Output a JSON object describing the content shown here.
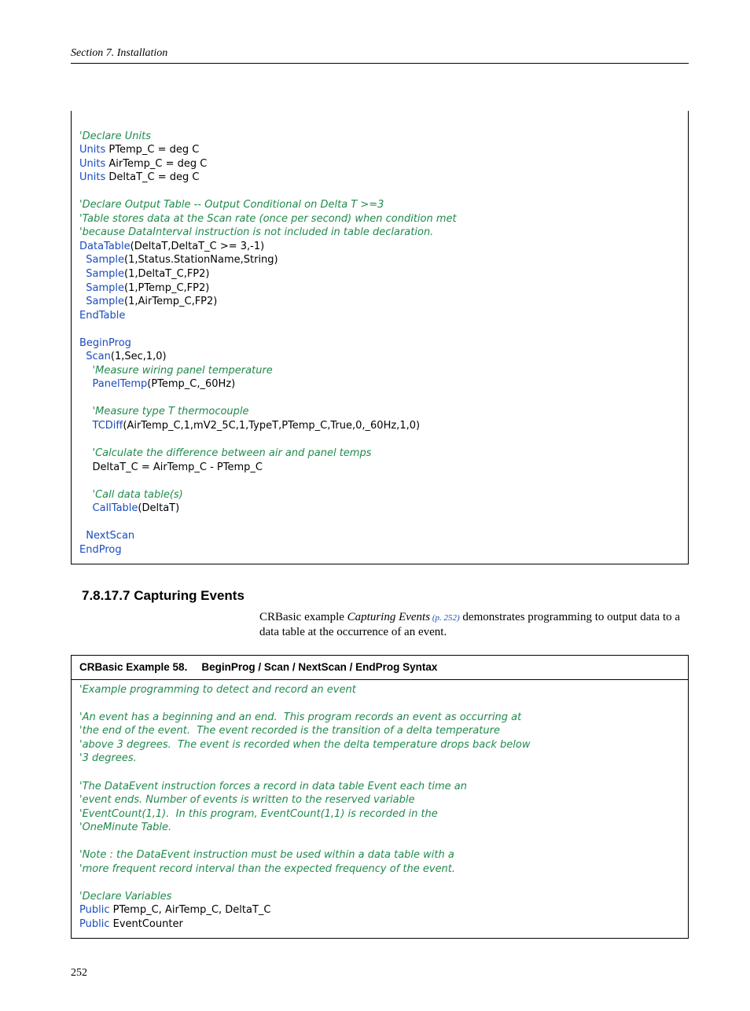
{
  "header": {
    "running": "Section 7.  Installation"
  },
  "code1": {
    "l1": "'Declare Units",
    "l2a": "Units",
    "l2b": " PTemp_C = deg C",
    "l3a": "Units",
    "l3b": " AirTemp_C = deg C",
    "l4a": "Units",
    "l4b": " DeltaT_C = deg C",
    "l5": "'Declare Output Table -- Output Conditional on Delta T >=3",
    "l6": "'Table stores data at the Scan rate (once per second) when condition met",
    "l7": "'because DataInterval instruction is not included in table declaration.",
    "l8a": "DataTable",
    "l8b": "(DeltaT,DeltaT_C >= 3,-1)",
    "l9a": "  Sample",
    "l9b": "(1,Status.StationName,String)",
    "l10a": "  Sample",
    "l10b": "(1,DeltaT_C,FP2)",
    "l11a": "  Sample",
    "l11b": "(1,PTemp_C,FP2)",
    "l12a": "  Sample",
    "l12b": "(1,AirTemp_C,FP2)",
    "l13": "EndTable",
    "l14": "BeginProg",
    "l15a": "  Scan",
    "l15b": "(1,Sec,1,0)",
    "l16": "    'Measure wiring panel temperature",
    "l17a": "    PanelTemp",
    "l17b": "(PTemp_C,_60Hz)",
    "l18": "    'Measure type T thermocouple",
    "l19a": "    TCDiff",
    "l19b": "(AirTemp_C,1,mV2_5C,1,TypeT,PTemp_C,True,0,_60Hz,1,0)",
    "l20": "    'Calculate the difference between air and panel temps",
    "l21": "    DeltaT_C = AirTemp_C - PTemp_C",
    "l22": "    'Call data table(s)",
    "l23a": "    CallTable",
    "l23b": "(DeltaT)",
    "l24": "  NextScan",
    "l25": "EndProg"
  },
  "section": {
    "number": "7.8.17.7",
    "title": "Capturing Events",
    "para_lead": "CRBasic example ",
    "para_xref_ital": "Capturing Events",
    "para_xref_page": " (p. 252)",
    "para_tail": " demonstrates programming to output data to a data table at the occurrence of an event."
  },
  "example": {
    "num_label": "CRBasic Example 58.",
    "title": "BeginProg / Scan / NextScan / EndProg Syntax"
  },
  "code2": {
    "c1": "'Example programming to detect and record an event",
    "c2": "'An event has a beginning and an end.  This program records an event as occurring at",
    "c3": "'the end of the event.  The event recorded is the transition of a delta temperature",
    "c4": "'above 3 degrees.  The event is recorded when the delta temperature drops back below",
    "c5": "'3 degrees.",
    "c6": "'The DataEvent instruction forces a record in data table Event each time an",
    "c7": "'event ends. Number of events is written to the reserved variable",
    "c8": "'EventCount(1,1).  In this program, EventCount(1,1) is recorded in the",
    "c9": "'OneMinute Table.",
    "c10": "'Note : the DataEvent instruction must be used within a data table with a",
    "c11": "'more frequent record interval than the expected frequency of the event.",
    "c12": "'Declare Variables",
    "c13a": "Public",
    "c13b": " PTemp_C, AirTemp_C, DeltaT_C",
    "c14a": "Public",
    "c14b": " EventCounter"
  },
  "footer": {
    "page_number": "252"
  }
}
